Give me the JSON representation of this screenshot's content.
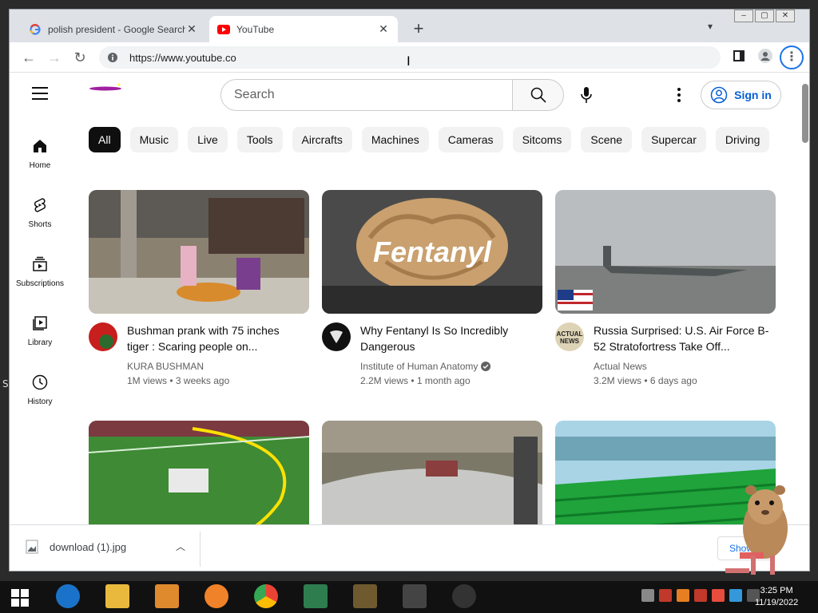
{
  "browser": {
    "tabs": [
      {
        "title": "polish president - Google Search",
        "icon": "google-icon",
        "active": false
      },
      {
        "title": "YouTube",
        "icon": "youtube-icon",
        "active": true
      }
    ],
    "new_tab": "+",
    "url": "https://www.youtube.co",
    "accent": "#1a73e8"
  },
  "youtube": {
    "search_placeholder": "Search",
    "sign_in": "Sign in",
    "guide": [
      {
        "label": "Home",
        "icon": "home-icon"
      },
      {
        "label": "Shorts",
        "icon": "shorts-icon"
      },
      {
        "label": "Subscriptions",
        "icon": "subscriptions-icon"
      },
      {
        "label": "Library",
        "icon": "library-icon"
      },
      {
        "label": "History",
        "icon": "history-icon"
      }
    ],
    "chips": [
      "All",
      "Music",
      "Live",
      "Tools",
      "Aircrafts",
      "Machines",
      "Cameras",
      "Sitcoms",
      "Scene",
      "Supercar",
      "Driving"
    ],
    "videos": [
      {
        "title": "Bushman prank with 75 inches tiger : Scaring people on...",
        "channel": "KURA BUSHMAN",
        "verified": false,
        "views": "1M views",
        "age": "3 weeks ago"
      },
      {
        "title": "Why Fentanyl Is So Incredibly Dangerous",
        "channel": "Institute of Human Anatomy",
        "verified": true,
        "views": "2.2M views",
        "age": "1 month ago",
        "thumb_text": "Fentanyl"
      },
      {
        "title": "Russia Surprised: U.S. Air Force B-52 Stratofortress Take Off...",
        "channel": "Actual News",
        "verified": false,
        "views": "3.2M views",
        "age": "6 days ago",
        "avatar_text": "ACTUAL NEWS"
      }
    ]
  },
  "download_shelf": {
    "file": "download (1).jpg",
    "show_all": "Show all"
  },
  "taskbar": {
    "time": "3:25 PM",
    "date": "11/19/2022"
  },
  "desktop_text": "S"
}
